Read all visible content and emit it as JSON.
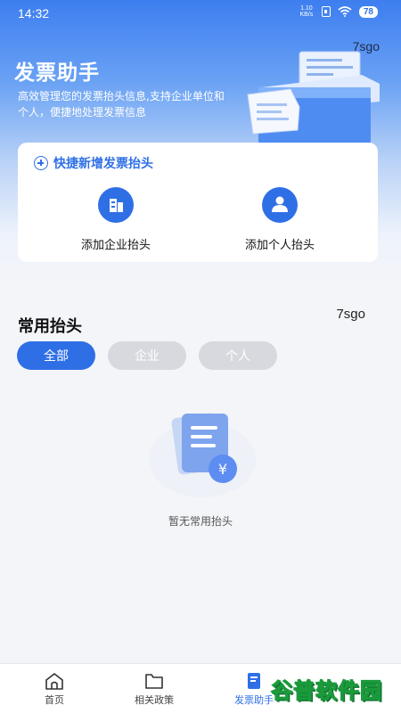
{
  "status": {
    "time": "14:32",
    "net_speed_value": "1.10",
    "net_speed_unit": "KB/s",
    "battery": "78"
  },
  "watermark": "7sgo",
  "header": {
    "title": "发票助手",
    "description": "高效管理您的发票抬头信息,支持企业单位和个人，便捷地处理发票信息"
  },
  "quick_add": {
    "title": "快捷新增发票抬头",
    "items": [
      {
        "label": "添加企业抬头",
        "icon": "building-icon"
      },
      {
        "label": "添加个人抬头",
        "icon": "person-icon"
      }
    ]
  },
  "common": {
    "title": "常用抬头",
    "filters": [
      {
        "label": "全部",
        "active": true
      },
      {
        "label": "企业",
        "active": false
      },
      {
        "label": "个人",
        "active": false
      }
    ],
    "empty_text": "暂无常用抬头"
  },
  "tabbar": {
    "tabs": [
      {
        "label": "首页",
        "icon": "home-icon"
      },
      {
        "label": "相关政策",
        "icon": "folder-icon"
      },
      {
        "label": "发票助手",
        "icon": "invoice-icon",
        "active": true
      }
    ]
  },
  "site_logo": "谷普软件园",
  "colors": {
    "primary": "#2f6fe6",
    "chip_inactive": "#d7d9de",
    "logo_green": "#2dbb4a"
  }
}
